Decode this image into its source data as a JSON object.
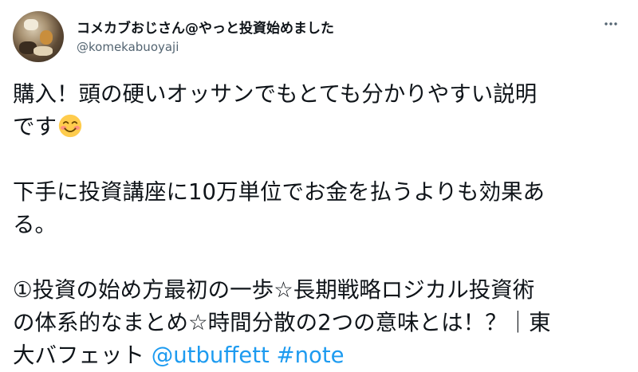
{
  "user": {
    "display_name": "コメカブおじさん@やっと投資始めました",
    "handle": "@komekabuoyaji"
  },
  "more_icon": "more-horizontal-icon",
  "tweet": {
    "line1": "購入！頭の硬いオッサンでもとても分かりやすい説明",
    "line2": "です",
    "emoji": "smiling-face-with-smiling-eyes",
    "line3": "下手に投資講座に10万単位でお金を払うよりも効果あ",
    "line4": "る。",
    "line5": "①投資の始め方最初の一歩☆長期戦略ロジカル投資術",
    "line6": "の体系的なまとめ☆時間分散の2つの意味とは！？｜東",
    "line7_text": "大バフェット ",
    "mention": "@utbuffett",
    "hashtag": "#note"
  },
  "colors": {
    "text": "#0f1419",
    "secondary": "#536471",
    "link": "#1d9bf0"
  }
}
